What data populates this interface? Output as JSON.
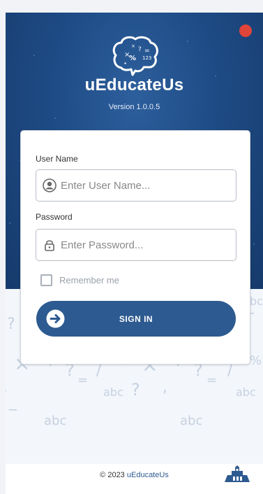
{
  "app": {
    "name": "uEducateUs",
    "version": "Version 1.0.0.5"
  },
  "form": {
    "username_label": "User Name",
    "username_placeholder": "Enter User Name...",
    "password_label": "Password",
    "password_placeholder": "Enter Password...",
    "remember_label": "Remember me",
    "remember_checked": false,
    "signin_label": "SIGN IN"
  },
  "footer": {
    "copyright_prefix": "© 2023 ",
    "copyright_brand": "uEducateUs"
  },
  "colors": {
    "brand_blue": "#1e4b85",
    "button_blue": "#2d5a90",
    "status_red": "#e0453a"
  },
  "icons": {
    "logo": "brain-symbols-icon",
    "status": "status-dot-icon",
    "username": "user-circle-icon",
    "password": "lock-icon",
    "signin": "arrow-right-circle-icon",
    "footer": "building-icon"
  }
}
